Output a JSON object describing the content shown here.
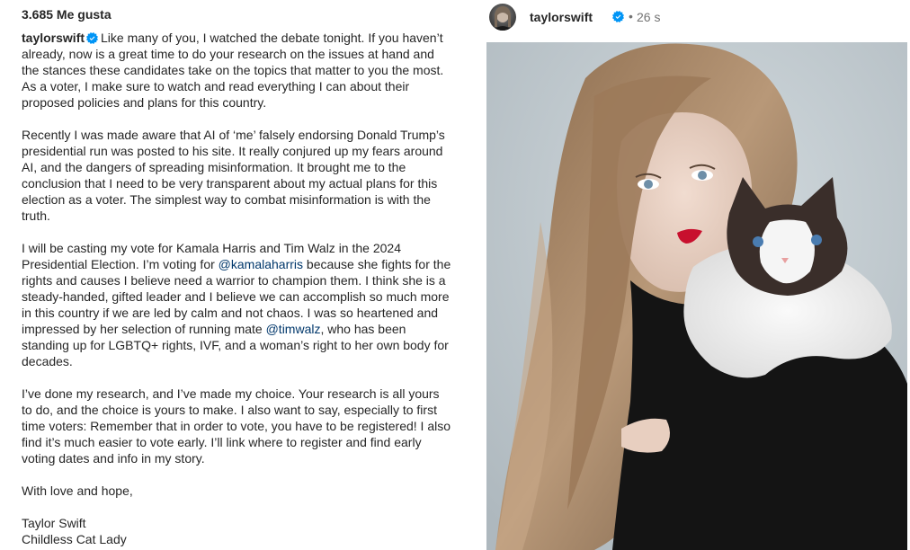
{
  "likes": "3.685 Me gusta",
  "post": {
    "username": "taylorswift",
    "time": "26 s",
    "more_label": "•••",
    "photo_icon": "post-photo"
  },
  "caption": {
    "username": "taylorswift",
    "p1": "Like many of you, I watched the debate tonight. If you haven’t already, now is a great time to do your research on the issues at hand and the stances these candidates take on the topics that matter to you the most. As a voter, I make sure to watch and read everything I can about their proposed policies and plans for this country.",
    "p2": "Recently I was made aware that AI of ‘me’ falsely endorsing Donald Trump’s presidential run was posted to his site. It really conjured up my fears around AI, and the dangers of spreading misinformation. It brought me to the conclusion that I need to be very transparent about my actual plans for this election as a voter. The simplest way to combat misinformation is with the truth.",
    "p3a": "I will be casting my vote for Kamala Harris and Tim Walz in the 2024 Presidential Election. I’m voting for ",
    "mention1": "@kamalaharris",
    "p3b": " because she fights for the rights and causes I believe need a warrior to champion them. I think she is a steady-handed, gifted leader and I believe we can accomplish so much more in this country if we are led by calm and not chaos. I was so heartened and impressed by her selection of running mate ",
    "mention2": "@timwalz",
    "p3c": ", who has been standing up for LGBTQ+ rights, IVF, and a woman’s right to her own body for decades.",
    "p4": "I’ve done my research, and I’ve made my choice. Your research is all yours to do, and the choice is yours to make. I also want to say, especially to first time voters: Remember that in order to vote, you have to be registered! I also find it’s much easier to vote early. I’ll link where to register and find early voting dates and info in my story.",
    "p5": "With love and hope,",
    "sign1": "Taylor Swift",
    "sign2": "Childless Cat Lady"
  },
  "colors": {
    "text": "#262626",
    "secondary": "#737373",
    "mention": "#00376b",
    "verified": "#0095f6"
  }
}
